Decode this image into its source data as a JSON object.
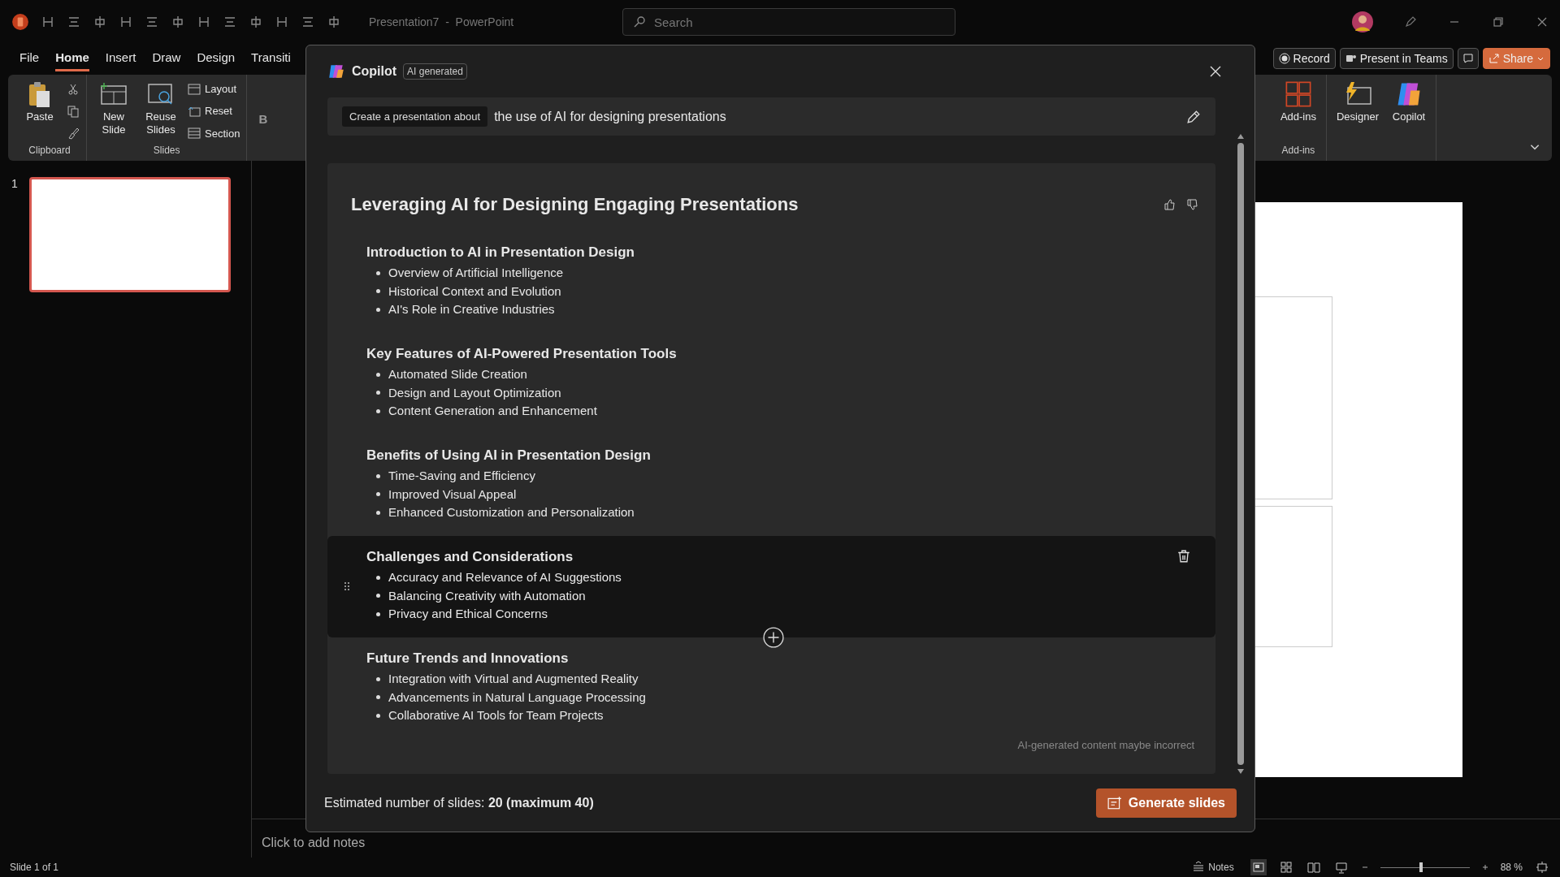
{
  "app": {
    "title": "Presentation7  -  PowerPoint",
    "search_placeholder": "Search"
  },
  "ribbon_tabs": [
    {
      "label": "File",
      "selected": false
    },
    {
      "label": "Home",
      "selected": true
    },
    {
      "label": "Insert",
      "selected": false
    },
    {
      "label": "Draw",
      "selected": false
    },
    {
      "label": "Design",
      "selected": false
    },
    {
      "label": "Transiti",
      "selected": false
    }
  ],
  "header_buttons": [
    {
      "label": "Record",
      "kind": "record"
    },
    {
      "label": "Present in Teams",
      "kind": "teams"
    },
    {
      "label": "Share",
      "kind": "share"
    }
  ],
  "ribbon": {
    "clipboard": {
      "paste": "Paste",
      "label": "Clipboard"
    },
    "slides": {
      "new_slide": "New Slide",
      "reuse": "Reuse Slides",
      "layout": "Layout",
      "reset": "Reset",
      "section": "Section",
      "label": "Slides"
    },
    "font": {
      "bold": "B"
    },
    "addins": {
      "buttons": [
        "Add-ins",
        "Designer",
        "Copilot"
      ],
      "label": "Add-ins"
    }
  },
  "thumbnails": [
    {
      "number": "1",
      "selected": true
    }
  ],
  "notes_placeholder": "Click to add notes",
  "status_bar": {
    "slide": "Slide 1 of 1",
    "notes": "Notes",
    "zoom": "88 %",
    "zoom_slider": {
      "level": 0.44
    }
  },
  "copilot": {
    "title": "Copilot",
    "badge": "AI generated",
    "prompt_prefix": "Create a presentation about",
    "prompt": "the use of AI for designing presentations",
    "outline_title": "Leveraging AI for Designing Engaging Presentations",
    "sections": [
      {
        "heading": "Introduction to AI in Presentation Design",
        "bullets": [
          "Overview of Artificial Intelligence",
          "Historical Context and Evolution",
          "AI's Role in Creative Industries"
        ],
        "selected": false
      },
      {
        "heading": "Key Features of AI-Powered Presentation Tools",
        "bullets": [
          "Automated Slide Creation",
          "Design and Layout Optimization",
          "Content Generation and Enhancement"
        ],
        "selected": false
      },
      {
        "heading": "Benefits of Using AI in Presentation Design",
        "bullets": [
          "Time-Saving and Efficiency",
          "Improved Visual Appeal",
          "Enhanced Customization and Personalization"
        ],
        "selected": false
      },
      {
        "heading": "Challenges and Considerations",
        "bullets": [
          "Accuracy and Relevance of AI Suggestions",
          "Balancing Creativity with Automation",
          "Privacy and Ethical Concerns"
        ],
        "selected": true
      },
      {
        "heading": "Future Trends and Innovations",
        "bullets": [
          "Integration with Virtual and Augmented Reality",
          "Advancements in Natural Language Processing",
          "Collaborative AI Tools for Team Projects"
        ],
        "selected": false
      }
    ],
    "disclaimer": "AI-generated content maybe incorrect",
    "estimate": "Estimated number of slides: **20 (maximum 40)**",
    "generate": "Generate slides"
  }
}
